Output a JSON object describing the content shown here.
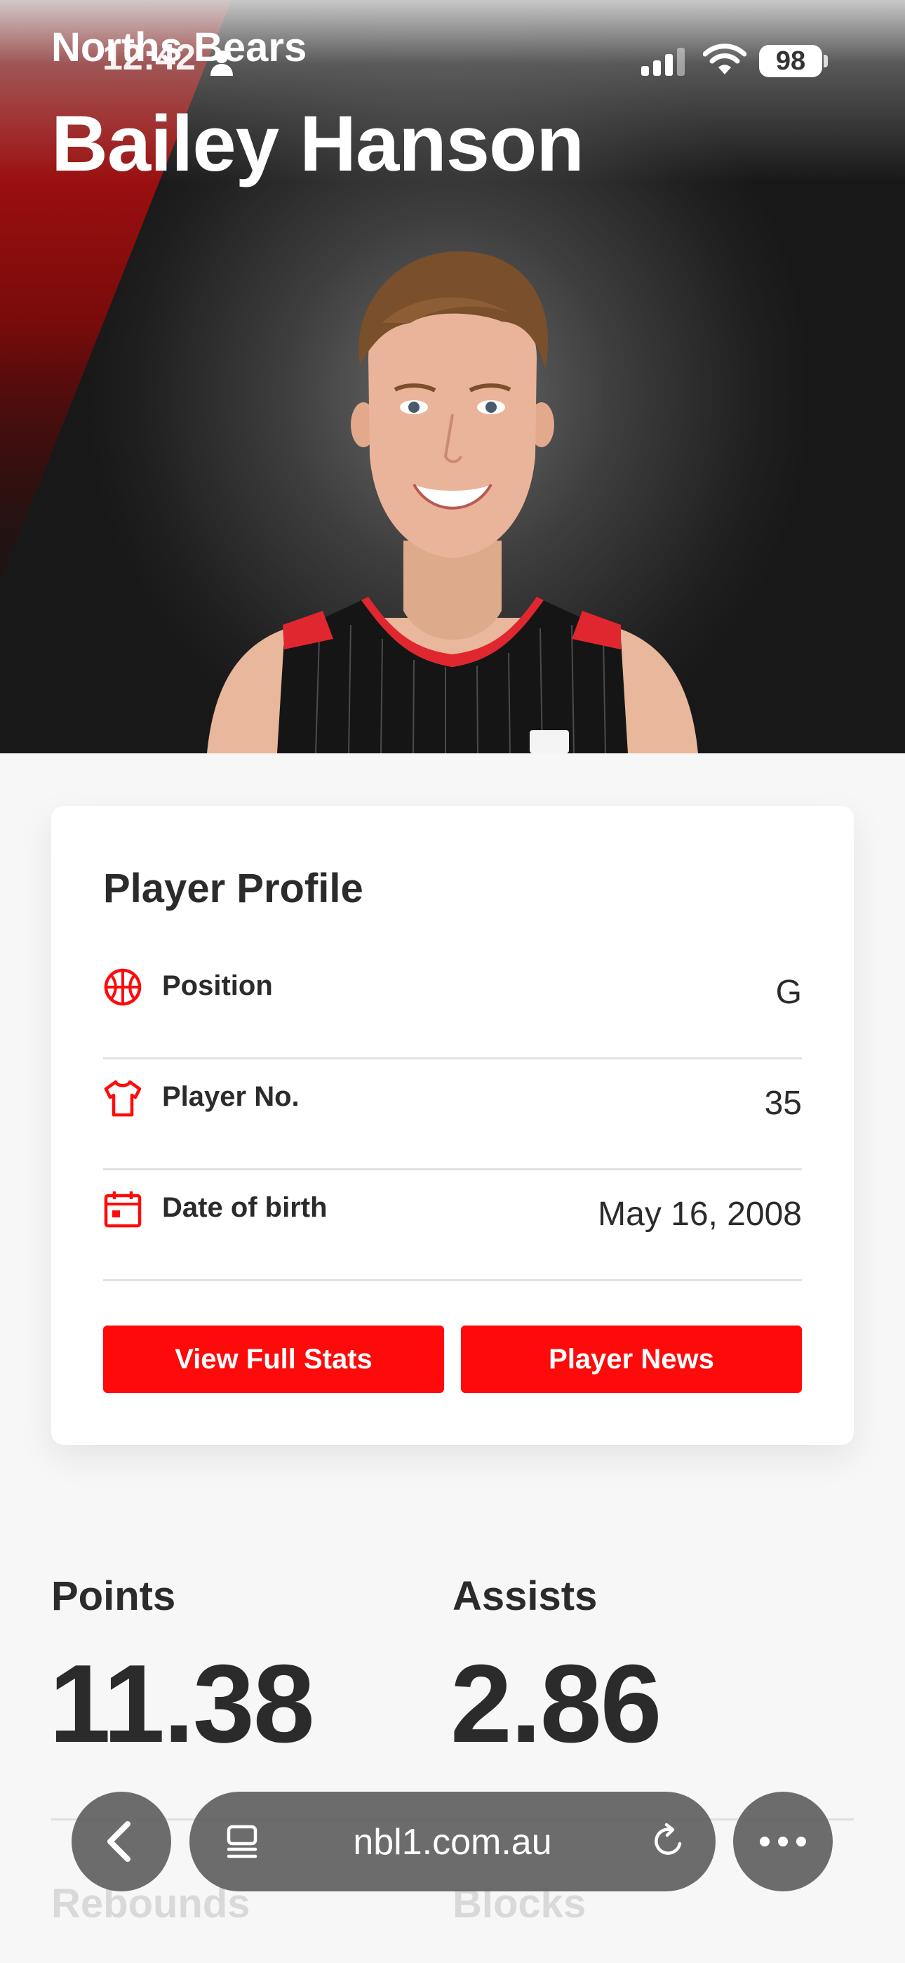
{
  "status_bar": {
    "time": "12:42",
    "battery": "98"
  },
  "hero": {
    "team": "Norths Bears",
    "player_name": "Bailey Hanson"
  },
  "profile": {
    "title": "Player Profile",
    "rows": [
      {
        "icon": "basketball-icon",
        "label": "Position",
        "value": "G"
      },
      {
        "icon": "jersey-icon",
        "label": "Player No.",
        "value": "35"
      },
      {
        "icon": "calendar-icon",
        "label": "Date of birth",
        "value": "May 16, 2008"
      }
    ],
    "buttons": {
      "full_stats": "View Full Stats",
      "news": "Player News"
    }
  },
  "stats": [
    {
      "label": "Points",
      "value": "11.38"
    },
    {
      "label": "Assists",
      "value": "2.86"
    },
    {
      "label": "Rebounds"
    },
    {
      "label": "Blocks"
    }
  ],
  "browser": {
    "url": "nbl1.com.au"
  },
  "colors": {
    "accent": "#ff0a0a",
    "text": "#2b2b2b",
    "background": "#f7f7f7"
  }
}
